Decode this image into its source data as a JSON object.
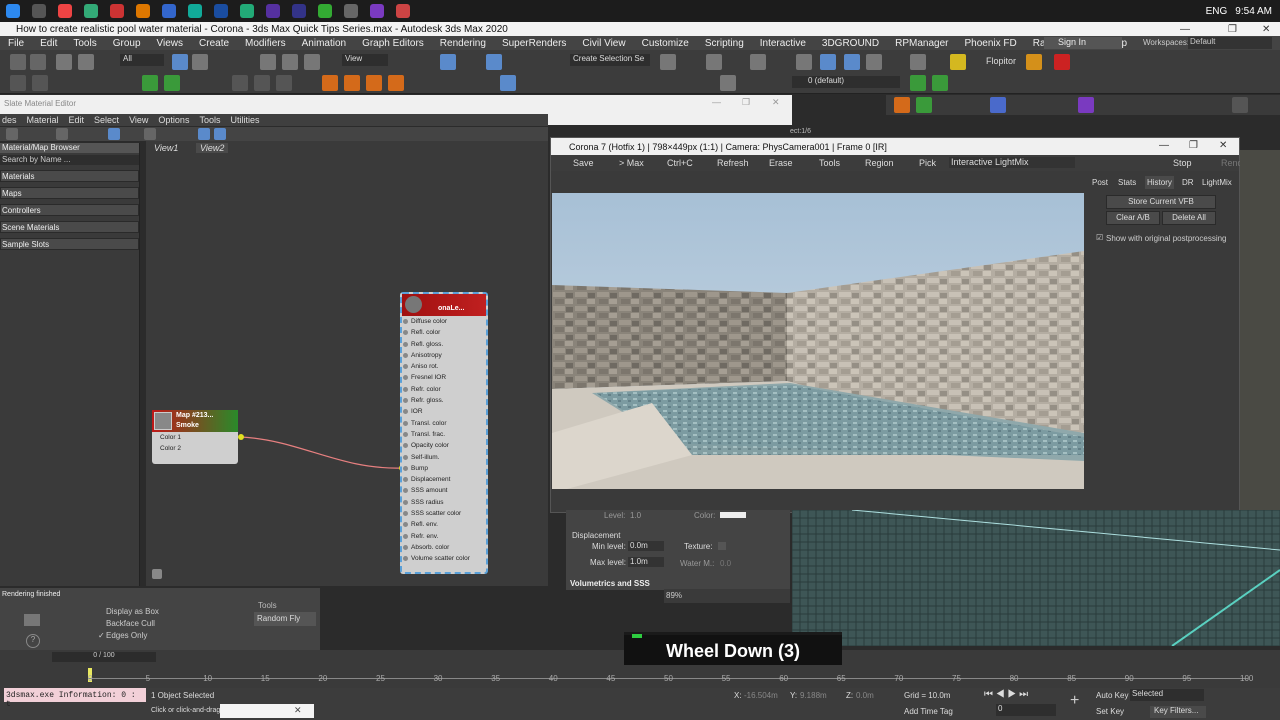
{
  "window_title": "How to create realistic pool water material - Corona - 3ds Max Quick Tips Series.max - Autodesk 3ds Max 2020",
  "menu": [
    "File",
    "Edit",
    "Tools",
    "Group",
    "Views",
    "Create",
    "Modifiers",
    "Animation",
    "Graph Editors",
    "Rendering",
    "SuperRenders",
    "Civil View",
    "Customize",
    "Scripting",
    "Interactive",
    "3DGROUND",
    "RPManager",
    "Phoenix FD",
    "RaypaTools3",
    "Help"
  ],
  "signin": "Sign In",
  "workspaces_label": "Workspaces:",
  "workspace_value": "Default",
  "clock": "9:54 AM",
  "lang": "ENG",
  "selection_filter": "All",
  "view_dropdown": "View",
  "create_selection": "Create Selection Se",
  "layer_dropdown": "0 (default)",
  "flopitor": "Flopitor",
  "sme": {
    "title": "Slate Material Editor",
    "menu": [
      "des",
      "Material",
      "Edit",
      "Select",
      "View",
      "Options",
      "Tools",
      "Utilities"
    ],
    "browser_title": "Material/Map Browser",
    "search": "Search by Name ...",
    "groups": [
      "Materials",
      "Maps",
      "Controllers",
      "Scene Materials",
      "Sample Slots"
    ],
    "view_tabs": [
      "View1",
      "View2"
    ],
    "status": "Rendering finished"
  },
  "nodes": {
    "output_title": "onaLe...",
    "output_slots": [
      "Diffuse color",
      "Refl. color",
      "Refl. gloss.",
      "Anisotropy",
      "Aniso rot.",
      "Fresnel IOR",
      "Refr. color",
      "Refr. gloss.",
      "IOR",
      "Transl. color",
      "Transl. frac.",
      "Opacity color",
      "Self-illum.",
      "Bump",
      "Displacement",
      "SSS amount",
      "SSS radius",
      "SSS scatter color",
      "Refl. env.",
      "Refr. env.",
      "Absorb. color",
      "Volume scatter color"
    ],
    "map_title": "Map #213...",
    "map_sub": "Smoke",
    "map_slots": [
      "Color 1",
      "Color 2"
    ]
  },
  "vfb": {
    "title": "Corona 7 (Hotfix 1) | 798×449px (1:1) | Camera: PhysCamera001 | Frame 0 [IR]",
    "tools": [
      "Save",
      "> Max",
      "Ctrl+C",
      "Refresh",
      "Erase",
      "Tools",
      "Region",
      "Pick"
    ],
    "lightmix": "Interactive LightMix",
    "stop": "Stop",
    "render": "Render",
    "tabs": [
      "Post",
      "Stats",
      "History",
      "DR",
      "LightMix"
    ],
    "store_btn": "Store Current VFB",
    "clear_btn": "Clear A/B",
    "delete_btn": "Delete All",
    "checkbox": "Show with original postprocessing",
    "sel_text": "ect:1/6"
  },
  "params": {
    "level_label": "Level:",
    "level_val": "1.0",
    "color_label": "Color:",
    "section": "Displacement",
    "min_label": "Min level:",
    "min_val": "0.0m",
    "max_label": "Max level:",
    "max_val": "1.0m",
    "texture_label": "Texture:",
    "water_label": "Water M.:",
    "water_val": "0.0",
    "volumetrics": "Volumetrics and SSS",
    "zoom": "89%"
  },
  "left_panel": {
    "display_as_box": "Display as Box",
    "backface": "Backface Cull",
    "edges": "Edges Only",
    "tools": "Tools",
    "random_fly": "Random Fly",
    "frames": "0 / 100"
  },
  "caption": "Wheel Down (3)",
  "ticks": [
    "0",
    "5",
    "10",
    "15",
    "20",
    "25",
    "30",
    "35",
    "40",
    "45",
    "50",
    "55",
    "60",
    "65",
    "70",
    "75",
    "80",
    "85",
    "90",
    "95",
    "100"
  ],
  "bottom": {
    "info": "3dsmax.exe Information: 0 : t",
    "selected": "1 Object Selected",
    "hint": "Click or click-and-drag",
    "x_label": "X:",
    "x_val": "-16.504m",
    "y_label": "Y:",
    "y_val": "9.188m",
    "z_label": "Z:",
    "z_val": "0.0m",
    "grid": "Grid = 10.0m",
    "add_time_tag": "Add Time Tag",
    "auto_key": "Auto Key",
    "set_key": "Set Key",
    "selected_dd": "Selected",
    "key_filters": "Key Filters...",
    "frame": "0"
  }
}
